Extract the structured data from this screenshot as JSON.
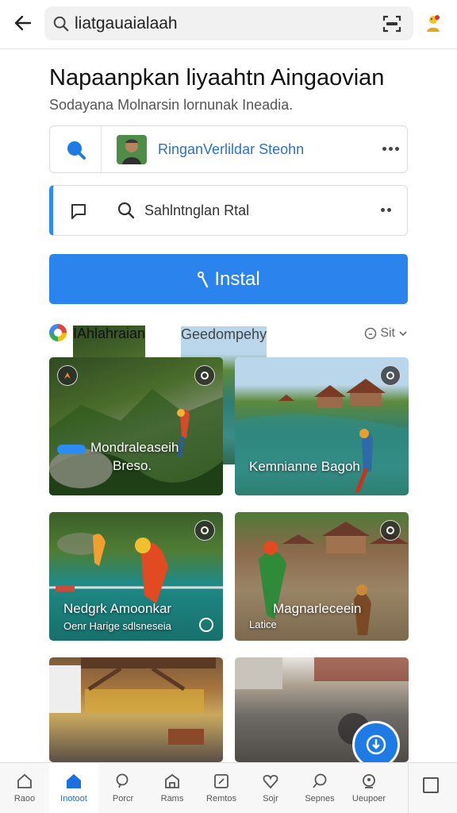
{
  "search": {
    "value": "liatgauaialaah"
  },
  "header": {
    "title": "Napaanpkan liyaahtn Aingaovian",
    "subtitle": "Sodayana Molnarsin lornunak Ineadia."
  },
  "card_profile": {
    "name": "RinganVerlildar Steohn"
  },
  "card_search": {
    "label": "Sahlntnglan Rtal"
  },
  "install_button": {
    "label": "Instal"
  },
  "section": {
    "title": "IAhlahraian",
    "tab": "Geedompehy",
    "sort": "Sit"
  },
  "tiles": [
    {
      "caption": "Mondraleaseih",
      "caption2": "Breso.",
      "icon": "compass-icon"
    },
    {
      "caption": "Kemnianne Bagoh",
      "caption2": "",
      "icon": "gear-icon"
    },
    {
      "caption": "Nedgrk Amoonkar",
      "caption2": "Oenr Harige    sdlsneseia",
      "icon": "gear-icon"
    },
    {
      "caption": "Magnarleceein",
      "caption2": "Latice",
      "icon": "gear-icon"
    },
    {
      "caption": "",
      "caption2": "",
      "icon": ""
    },
    {
      "caption": "",
      "caption2": "",
      "icon": "info-icon"
    }
  ],
  "nav": [
    {
      "label": "Raoo",
      "icon": "home-outline-icon"
    },
    {
      "label": "Inotoot",
      "icon": "home-filled-icon"
    },
    {
      "label": "Porcr",
      "icon": "search-icon"
    },
    {
      "label": "Rams",
      "icon": "store-icon"
    },
    {
      "label": "Remtos",
      "icon": "calendar-icon"
    },
    {
      "label": "Sojr",
      "icon": "heart-icon"
    },
    {
      "label": "Sepnes",
      "icon": "chat-search-icon"
    },
    {
      "label": "Ueupoer",
      "icon": "profile-icon"
    }
  ],
  "colors": {
    "accent": "#2b84ee",
    "link": "#2a72c8",
    "active_nav": "#1c6fe0"
  }
}
